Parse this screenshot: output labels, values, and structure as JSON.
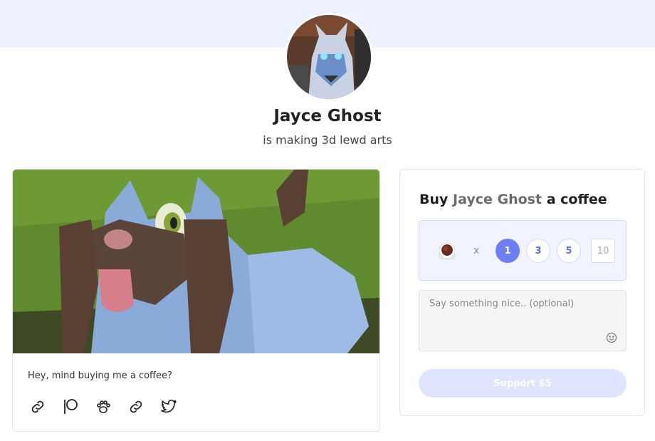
{
  "profile": {
    "name": "Jayce Ghost",
    "tagline": "is making 3d lewd arts"
  },
  "post": {
    "about": "Hey, mind buying me a coffee?",
    "links": [
      {
        "icon": "link-icon"
      },
      {
        "icon": "patreon-icon"
      },
      {
        "icon": "paw-icon"
      },
      {
        "icon": "link-icon"
      },
      {
        "icon": "twitter-icon"
      }
    ]
  },
  "support": {
    "title_prefix": "Buy",
    "title_name": "Jayce Ghost",
    "title_suffix": "a coffee",
    "times": "x",
    "quantities": [
      "1",
      "3",
      "5"
    ],
    "selected_quantity": "1",
    "custom_placeholder": "10",
    "message_placeholder": "Say something nice.. (optional)",
    "button_label": "Support $5"
  },
  "colors": {
    "banner": "#eef1ff",
    "accent": "#6c7ff5",
    "button_bg": "#dfe5ff"
  }
}
